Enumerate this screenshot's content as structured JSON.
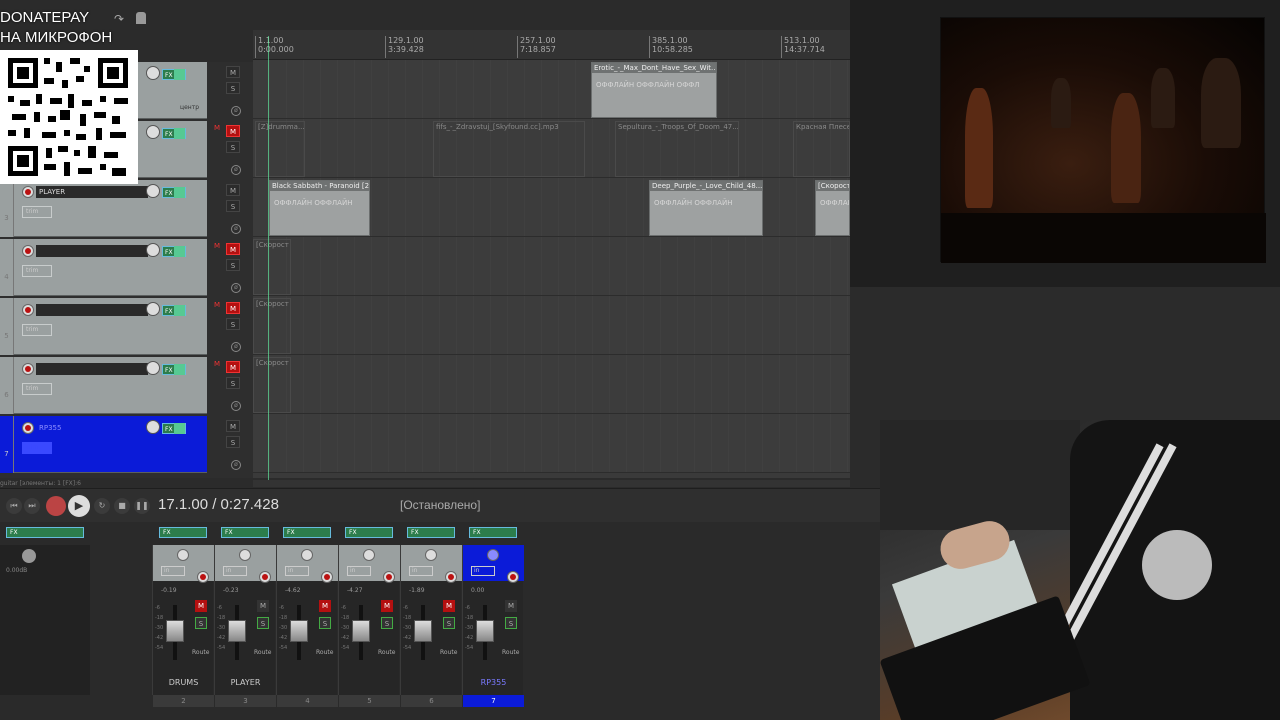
{
  "overlay": {
    "line1": "DONATEPAY",
    "line2": "НА МИКРОФОН"
  },
  "ruler": {
    "ticks": [
      {
        "bar": "1.1.00",
        "time": "0:00.000"
      },
      {
        "bar": "129.1.00",
        "time": "3:39.428"
      },
      {
        "bar": "257.1.00",
        "time": "7:18.857"
      },
      {
        "bar": "385.1.00",
        "time": "10:58.285"
      },
      {
        "bar": "513.1.00",
        "time": "14:37.714"
      }
    ]
  },
  "tracks": [
    {
      "num": "",
      "name": "",
      "label": "центр",
      "mute": false
    },
    {
      "num": "2",
      "name": "DRUMS",
      "mute": true
    },
    {
      "num": "3",
      "name": "PLAYER",
      "mute": false
    },
    {
      "num": "4",
      "name": "",
      "mute": true
    },
    {
      "num": "5",
      "name": "",
      "mute": true
    },
    {
      "num": "6",
      "name": "",
      "mute": true
    },
    {
      "num": "7",
      "name": "RP355",
      "mute": false
    }
  ],
  "trim_label": "trim",
  "fx_label": "FX",
  "clips": {
    "c1": {
      "title": "Erotic_-_Max_Dont_Have_Sex_Wit...",
      "body": "ОФФЛАЙН    ОФФЛАЙН    ОФФЛ"
    },
    "c2": {
      "title": "[Z]drumma...",
      "body": ""
    },
    "c3": {
      "title": "fifs_-_Zdravstuj_[Skyfound.cc].mp3",
      "body": ""
    },
    "c4": {
      "title": "Sepultura_-_Troops_Of_Doom_47...",
      "body": ""
    },
    "c5": {
      "title": "Красная Плесен...",
      "body": ""
    },
    "c6": {
      "title": "Black Sabbath - Paranoid [2...",
      "body": "ОФФЛАЙН    ОФФЛАЙН"
    },
    "c7": {
      "title": "Deep_Purple_-_Love_Child_48...",
      "body": "ОФФЛАЙН    ОФФЛАЙН"
    },
    "c8": {
      "title": "[Скорость",
      "body": "ОФФЛАЙН"
    },
    "c9": {
      "title": "[Скорост",
      "body": ""
    },
    "c10": {
      "title": "[Скорост",
      "body": ""
    },
    "c11": {
      "title": "[Скорост",
      "body": ""
    }
  },
  "path_line": "guitar [элементы: 1 [FX]:6",
  "transport": {
    "time": "17.1.00 / 0:27.428",
    "status": "[Остановлено]"
  },
  "mixer": {
    "master_db": "0.00dB",
    "strips": [
      {
        "name": "DRUMS",
        "num": "2",
        "db": "-0.19",
        "mute": true
      },
      {
        "name": "PLAYER",
        "num": "3",
        "db": "-0.23",
        "mute": false
      },
      {
        "name": "",
        "num": "4",
        "db": "-4.62",
        "mute": true
      },
      {
        "name": "",
        "num": "5",
        "db": "-4.27",
        "mute": true
      },
      {
        "name": "",
        "num": "6",
        "db": "-1.89",
        "mute": true
      },
      {
        "name": "RP355",
        "num": "7",
        "db": "0.00",
        "mute": false
      }
    ],
    "in_label": "in",
    "route_label": "Route",
    "scale": [
      "-6",
      "-18",
      "-30",
      "-42",
      "-54"
    ]
  }
}
